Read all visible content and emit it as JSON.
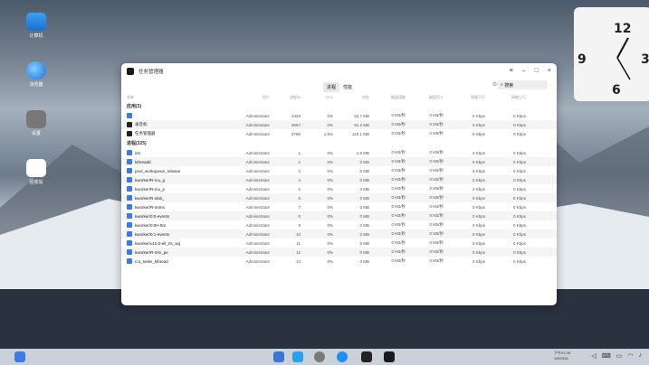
{
  "desktop": {
    "icons": [
      {
        "label": "计算机",
        "icon": "computer-icon"
      },
      {
        "label": "浏览器",
        "icon": "browser-icon"
      },
      {
        "label": "设置",
        "icon": "settings-icon"
      },
      {
        "label": "回收站",
        "icon": "trash-icon"
      }
    ]
  },
  "clock": {
    "numerals": [
      "12",
      "9",
      "3",
      "6"
    ]
  },
  "window": {
    "title": "任务管理器",
    "controls": {
      "menu": "≡",
      "min": "–",
      "max": "□",
      "close": "×"
    },
    "tabs": [
      "进程",
      "性能"
    ],
    "search_placeholder": "搜索",
    "columns": [
      "名称",
      "用户",
      "进程ID",
      "CPU",
      "内存",
      "磁盘读取",
      "磁盘写入",
      "网络下行",
      "网络上行"
    ],
    "sections": [
      {
        "label": "应用(3)",
        "rows": [
          {
            "name": "",
            "user": "Administrator",
            "pid": "3429",
            "cpu": "0%",
            "mem": "52.7 MB",
            "dr": "0 KB/秒",
            "dw": "0 KB/秒",
            "nd": "0 Kbps",
            "nu": "0 Kbps"
          },
          {
            "name": "录音机",
            "user": "Administrator",
            "pid": "3657",
            "cpu": "0%",
            "mem": "91.2 MB",
            "dr": "0 KB/秒",
            "dw": "0 KB/秒",
            "nd": "0 Kbps",
            "nu": "0 Kbps"
          },
          {
            "name": "任务管理器",
            "user": "Administrator",
            "pid": "3790",
            "cpu": "1.6%",
            "mem": "119.1 MB",
            "dr": "0 KB/秒",
            "dw": "0 KB/秒",
            "nd": "0 Kbps",
            "nu": "0 Kbps"
          }
        ]
      },
      {
        "label": "进程(325)",
        "rows": [
          {
            "name": "init",
            "user": "Administrator",
            "pid": "1",
            "cpu": "0%",
            "mem": "1.9 MB",
            "dr": "0 KB/秒",
            "dw": "0 KB/秒",
            "nd": "0 Kbps",
            "nu": "0 Kbps"
          },
          {
            "name": "kthreadd",
            "user": "Administrator",
            "pid": "2",
            "cpu": "0%",
            "mem": "0 MB",
            "dr": "0 KB/秒",
            "dw": "0 KB/秒",
            "nd": "0 Kbps",
            "nu": "0 Kbps"
          },
          {
            "name": "pool_workqueue_release",
            "user": "Administrator",
            "pid": "3",
            "cpu": "0%",
            "mem": "0 MB",
            "dr": "0 KB/秒",
            "dw": "0 KB/秒",
            "nd": "0 Kbps",
            "nu": "0 Kbps"
          },
          {
            "name": "kworker/R-rcu_g",
            "user": "Administrator",
            "pid": "4",
            "cpu": "0%",
            "mem": "0 MB",
            "dr": "0 KB/秒",
            "dw": "0 KB/秒",
            "nd": "0 Kbps",
            "nu": "0 Kbps"
          },
          {
            "name": "kworker/R-rcu_p",
            "user": "Administrator",
            "pid": "5",
            "cpu": "0%",
            "mem": "0 MB",
            "dr": "0 KB/秒",
            "dw": "0 KB/秒",
            "nd": "0 Kbps",
            "nu": "0 Kbps"
          },
          {
            "name": "kworker/R-slub_",
            "user": "Administrator",
            "pid": "6",
            "cpu": "0%",
            "mem": "0 MB",
            "dr": "0 KB/秒",
            "dw": "0 KB/秒",
            "nd": "0 Kbps",
            "nu": "0 Kbps"
          },
          {
            "name": "kworker/R-netns",
            "user": "Administrator",
            "pid": "7",
            "cpu": "0%",
            "mem": "0 MB",
            "dr": "0 KB/秒",
            "dw": "0 KB/秒",
            "nd": "0 Kbps",
            "nu": "0 Kbps"
          },
          {
            "name": "kworker/0:0-events",
            "user": "Administrator",
            "pid": "8",
            "cpu": "0%",
            "mem": "0 MB",
            "dr": "0 KB/秒",
            "dw": "0 KB/秒",
            "nd": "0 Kbps",
            "nu": "0 Kbps"
          },
          {
            "name": "kworker/0:0H-ttm",
            "user": "Administrator",
            "pid": "9",
            "cpu": "0%",
            "mem": "0 MB",
            "dr": "0 KB/秒",
            "dw": "0 KB/秒",
            "nd": "0 Kbps",
            "nu": "0 Kbps"
          },
          {
            "name": "kworker/0:1-events",
            "user": "Administrator",
            "pid": "10",
            "cpu": "0%",
            "mem": "0 MB",
            "dr": "0 KB/秒",
            "dw": "0 KB/秒",
            "nd": "0 Kbps",
            "nu": "0 Kbps"
          },
          {
            "name": "kworker/u16:0-ell_rts_wq",
            "user": "Administrator",
            "pid": "11",
            "cpu": "0%",
            "mem": "0 MB",
            "dr": "0 KB/秒",
            "dw": "0 KB/秒",
            "nd": "0 Kbps",
            "nu": "0 Kbps"
          },
          {
            "name": "kworker/R-mm_pe",
            "user": "Administrator",
            "pid": "12",
            "cpu": "0%",
            "mem": "0 MB",
            "dr": "0 KB/秒",
            "dw": "0 KB/秒",
            "nd": "0 Kbps",
            "nu": "0 Kbps"
          },
          {
            "name": "rcu_tasks_kthread",
            "user": "Administrator",
            "pid": "13",
            "cpu": "0%",
            "mem": "0 MB",
            "dr": "0 KB/秒",
            "dw": "0 KB/秒",
            "nd": "0 Kbps",
            "nu": "0 Kbps"
          }
        ]
      }
    ]
  },
  "taskbar": {
    "time": "下午01:28",
    "date": "1/8/2026"
  },
  "colors": {
    "accent": "#3d7be4",
    "taskbar": "#dce1e8"
  }
}
